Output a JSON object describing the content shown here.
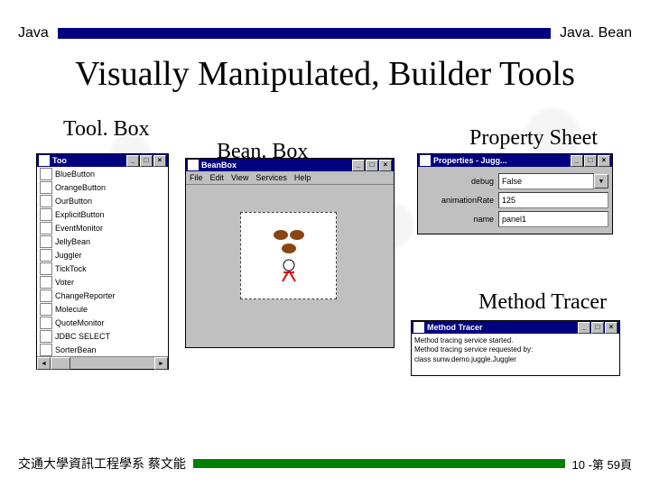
{
  "header": {
    "left": "Java",
    "right": "Java. Bean"
  },
  "title": "Visually Manipulated, Builder Tools",
  "labels": {
    "toolbox": "Tool. Box",
    "beanbox": "Bean. Box",
    "propsheet": "Property Sheet",
    "method_tracer": "Method Tracer"
  },
  "toolbox": {
    "title": "Too",
    "items": [
      "BlueButton",
      "OrangeButton",
      "OurButton",
      "ExplicitButton",
      "EventMonitor",
      "JellyBean",
      "Juggler",
      "TickTock",
      "Voter",
      "ChangeReporter",
      "Molecule",
      "QuoteMonitor",
      "JDBC SELECT",
      "SorterBean"
    ]
  },
  "beanbox": {
    "title": "BeanBox",
    "menu": [
      "File",
      "Edit",
      "View",
      "Services",
      "Help"
    ]
  },
  "properties": {
    "title": "Properties - Jugg...",
    "rows": [
      {
        "label": "debug",
        "value": "False",
        "dropdown": true
      },
      {
        "label": "animationRate",
        "value": "125",
        "dropdown": false
      },
      {
        "label": "name",
        "value": "panel1",
        "dropdown": false
      }
    ]
  },
  "tracer": {
    "title": "Method Tracer",
    "lines": [
      "Method tracing service started.",
      "Method tracing service requested by:",
      "  class sunw.demo.juggle.Juggler"
    ]
  },
  "footer": {
    "left": "交通大學資訊工程學系 蔡文能",
    "right": "10 -第 59頁"
  }
}
